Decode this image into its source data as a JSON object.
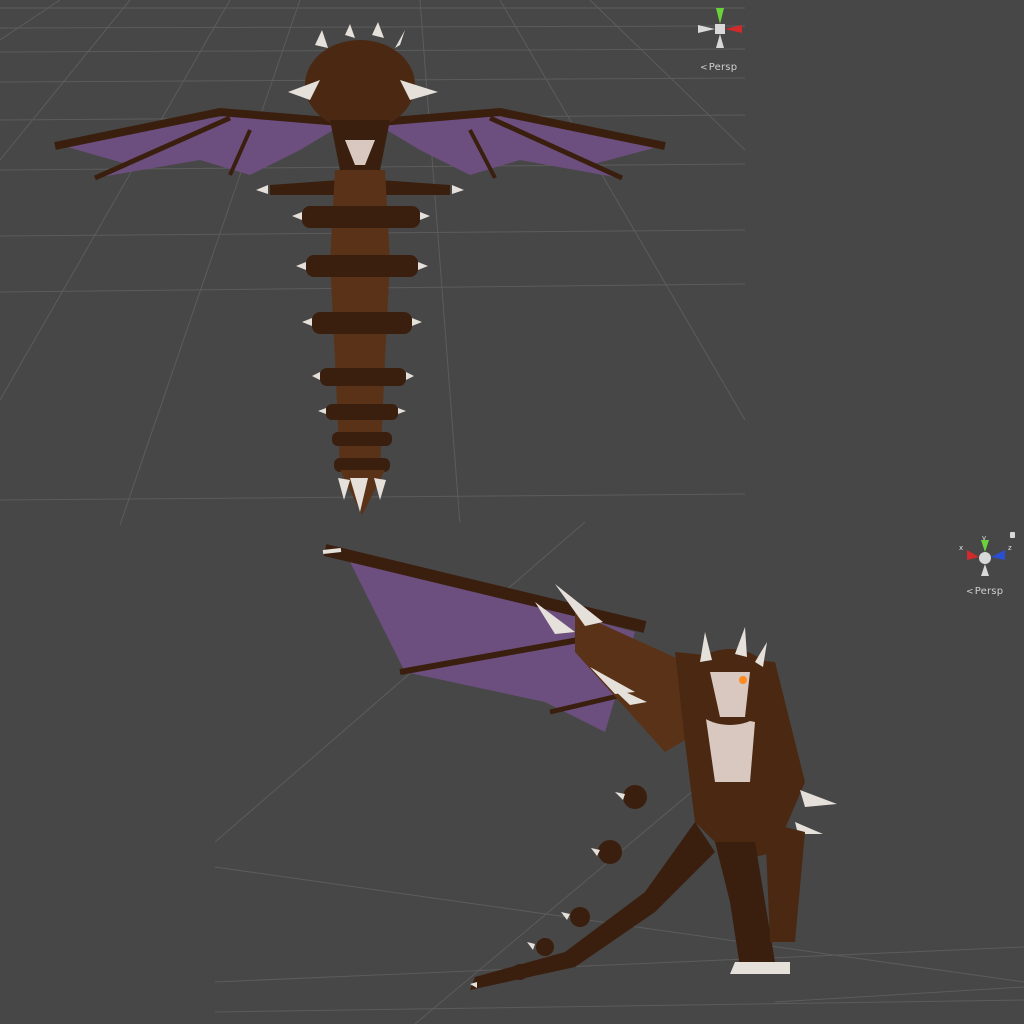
{
  "viewports": [
    {
      "id": "top",
      "gizmo": {
        "axes": [
          "y",
          "z"
        ],
        "projection_label": "Persp"
      }
    },
    {
      "id": "bottom",
      "gizmo": {
        "axes": [
          "x",
          "y",
          "z"
        ],
        "projection_label": "Persp"
      }
    }
  ],
  "colors": {
    "viewport_bg": "#474747",
    "grid_line": "#5c5c5c",
    "model_fur_dark": "#3a1e0e",
    "model_fur_mid": "#5a3218",
    "wing_membrane": "#6c4f7e",
    "claw_bone": "#e6e0da",
    "axis_x": "#d22a2a",
    "axis_y": "#6bd23a",
    "axis_z": "#2a4fd2"
  },
  "icons": [
    "scene-gizmo-icon",
    "dragon-model"
  ]
}
